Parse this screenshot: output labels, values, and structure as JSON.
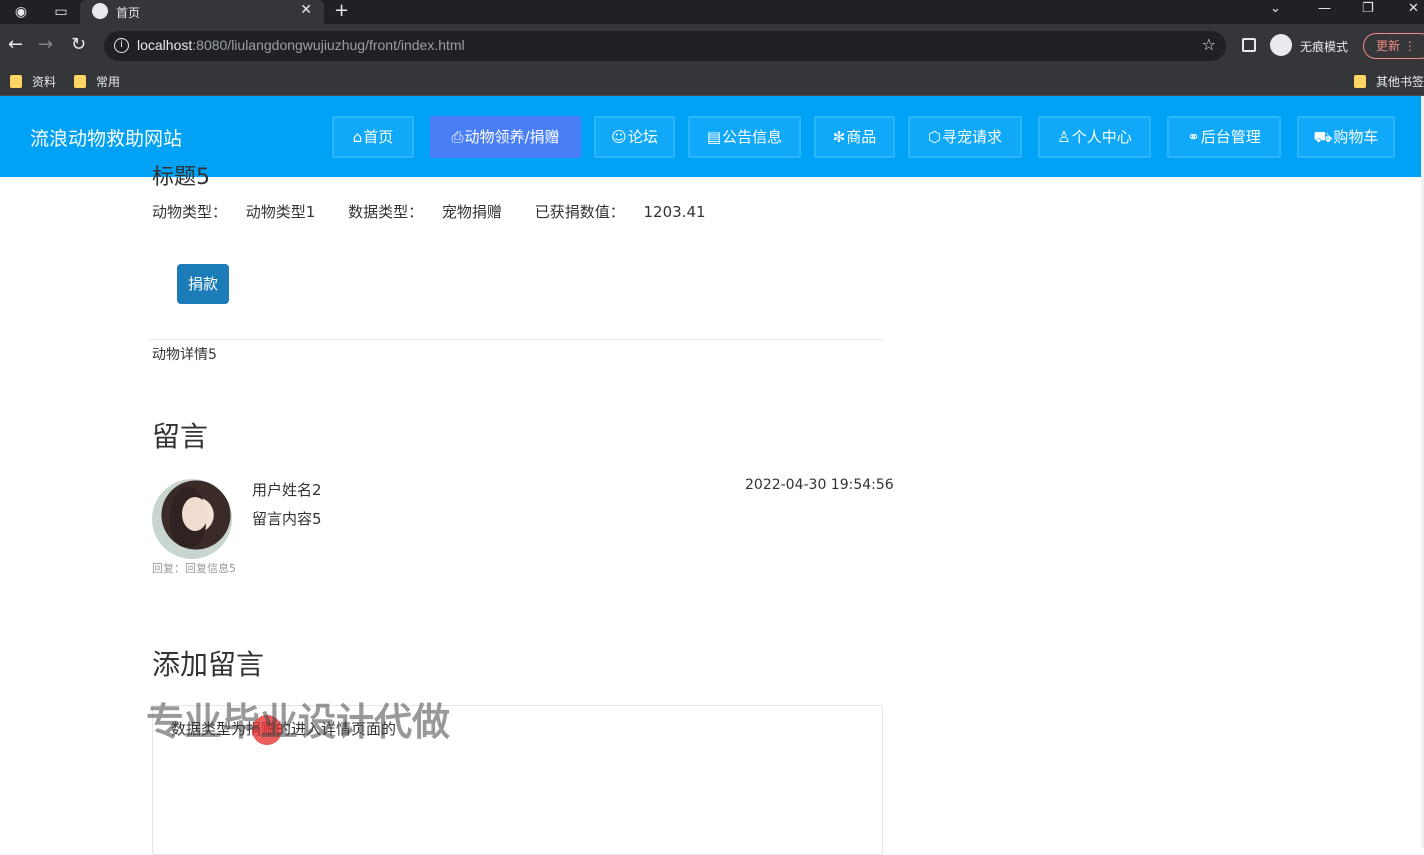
{
  "browser": {
    "tab_title": "首页",
    "url_host": "localhost",
    "url_rest": ":8080/liulangdongwujiuzhug/front/index.html",
    "incognito_label": "无痕模式",
    "update_label": "更新",
    "bookmarks": [
      "资料",
      "常用",
      "其他书签"
    ]
  },
  "site": {
    "title": "流浪动物救助网站",
    "nav": [
      {
        "icon": "⌂",
        "label": "首页"
      },
      {
        "icon": "⎙",
        "label": "动物领养/捐赠"
      },
      {
        "icon": "☺",
        "label": "论坛"
      },
      {
        "icon": "▤",
        "label": "公告信息"
      },
      {
        "icon": "✻",
        "label": "商品"
      },
      {
        "icon": "⬡",
        "label": "寻宠请求"
      },
      {
        "icon": "♙",
        "label": "个人中心"
      },
      {
        "icon": "⚭",
        "label": "后台管理"
      },
      {
        "icon": "⛟",
        "label": "购物车"
      }
    ]
  },
  "detail": {
    "title_cut": "标题5",
    "animal_type_label": "动物类型：",
    "animal_type_value": "动物类型1",
    "data_type_label": "数据类型：",
    "data_type_value": "宠物捐赠",
    "donated_label": "已获捐数值：",
    "donated_value": "1203.41",
    "donate_button": "捐款",
    "description": "动物详情5"
  },
  "comments": {
    "heading": "留言",
    "items": [
      {
        "user": "用户姓名2",
        "text": "留言内容5",
        "time": "2022-04-30 19:54:56",
        "reply": "回复：回复信息5"
      }
    ]
  },
  "add_comment": {
    "heading": "添加留言",
    "textarea_value": "数据类型为捐赠的进入详情页面的"
  },
  "overlay": {
    "watermark": "专业毕业设计代做"
  }
}
